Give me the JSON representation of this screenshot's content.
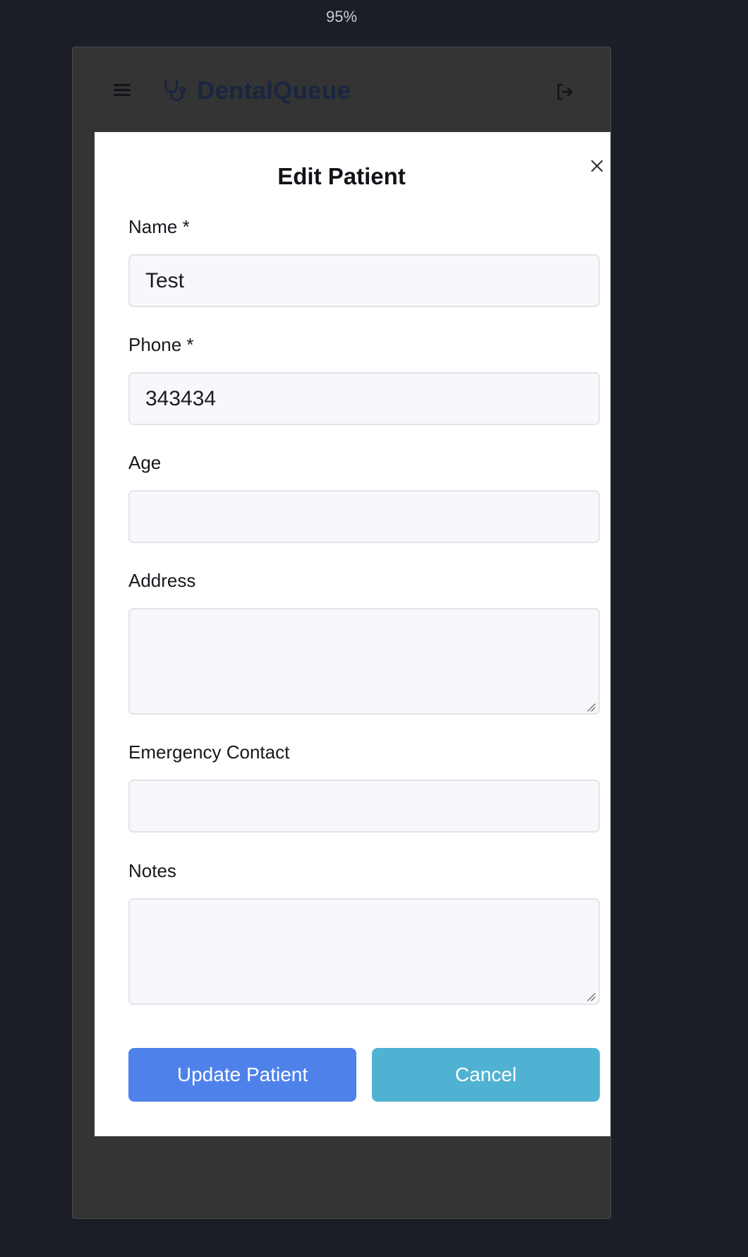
{
  "zoom": "95%",
  "header": {
    "brand_name": "DentalQueue",
    "menu_icon": "hamburger-menu-icon",
    "brand_icon": "stethoscope-icon",
    "logout_icon": "logout-icon"
  },
  "modal": {
    "title": "Edit Patient",
    "close_icon": "close-icon",
    "fields": {
      "name": {
        "label": "Name *",
        "value": "Test"
      },
      "phone": {
        "label": "Phone *",
        "value": "343434"
      },
      "age": {
        "label": "Age",
        "value": ""
      },
      "address": {
        "label": "Address",
        "value": ""
      },
      "emergency_contact": {
        "label": "Emergency Contact",
        "value": ""
      },
      "notes": {
        "label": "Notes",
        "value": ""
      }
    },
    "buttons": {
      "submit": "Update Patient",
      "cancel": "Cancel"
    }
  },
  "colors": {
    "page_background": "#1b1e26",
    "overlay": "#343434",
    "brand_text": "#1a2540",
    "primary_button": "#4e82ea",
    "secondary_button": "#50b2d2",
    "input_background": "#f7f8fb"
  }
}
